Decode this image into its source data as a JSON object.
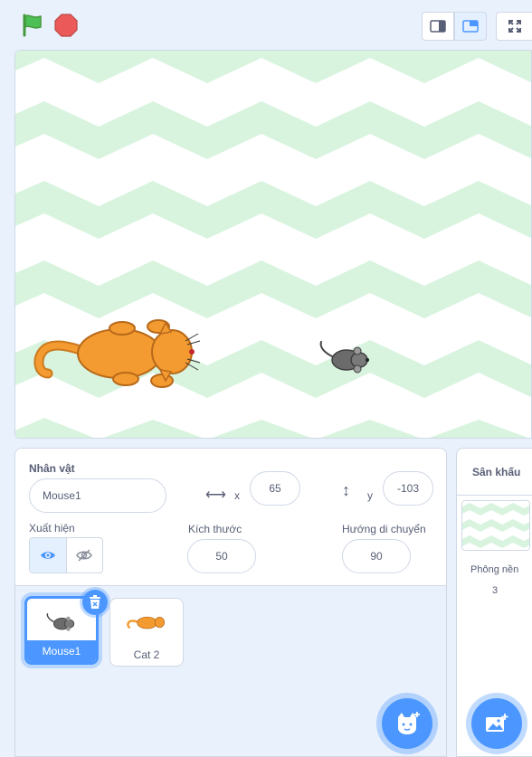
{
  "sprite_info": {
    "sprite_label": "Nhân vật",
    "sprite_name": "Mouse1",
    "x_label": "x",
    "x_value": "65",
    "y_label": "y",
    "y_value": "-103",
    "show_label": "Xuất hiện",
    "size_label": "Kích thước",
    "size_value": "50",
    "direction_label": "Hướng di chuyển",
    "direction_value": "90"
  },
  "sprites": [
    {
      "name": "Mouse1",
      "selected": true
    },
    {
      "name": "Cat 2",
      "selected": false
    }
  ],
  "stage_pane": {
    "title": "Sân khấu",
    "backdrops_label": "Phông nền",
    "backdrops_count": "3"
  },
  "colors": {
    "accent": "#4c97ff",
    "flag": "#4cbf56",
    "stop": "#ec5959",
    "backdrop_zigzag": "#d8f4df"
  },
  "icons": [
    "green-flag-icon",
    "stop-icon",
    "small-stage-icon",
    "normal-stage-icon",
    "fullscreen-icon",
    "horizontal-arrows-icon",
    "vertical-arrows-icon",
    "eye-icon",
    "eye-slash-icon",
    "trash-icon",
    "add-sprite-cat-icon",
    "add-backdrop-icon"
  ]
}
